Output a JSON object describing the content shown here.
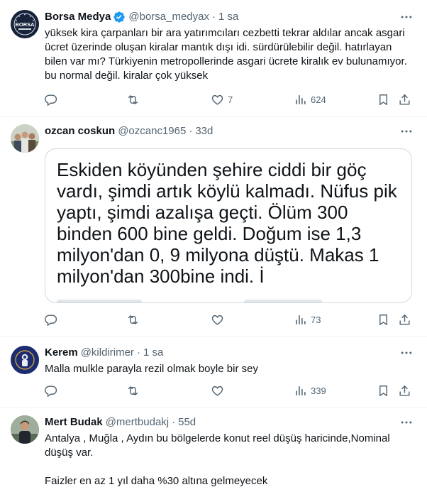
{
  "tweets": [
    {
      "name": "Borsa Medya",
      "handle": "@borsa_medyax",
      "dot": "·",
      "time": "1 sa",
      "text": "yüksek kira çarpanları bir ara yatırımcıları cezbetti tekrar aldılar ancak asgari ücret üzerinde oluşan kiralar mantık dışı idi. sürdürülebilir değil. hatırlayan bilen var mı? Türkiyenin metropollerinde asgari ücrete kiralık ev bulunamıyor. bu normal değil. kiralar çok yüksek",
      "replies": "",
      "retweets": "",
      "likes": "7",
      "views": "624",
      "avatar_text": "BORSA"
    },
    {
      "name": "ozcan coskun",
      "handle": "@ozcanc1965",
      "dot": "·",
      "time": "33d",
      "quote_text": "Eskiden köyünden şehire ciddi bir göç vardı, şimdi artık köylü kalmadı. Nüfus pik yaptı, şimdi azalışa geçti. Ölüm 300 binden 600 bine geldi. Doğum ise 1,3 milyon'dan 0, 9 milyona düştü. Makas 1 milyon'dan 300bine indi. İ",
      "replies": "",
      "retweets": "",
      "likes": "",
      "views": "73"
    },
    {
      "name": "Kerem",
      "handle": "@kildirimer",
      "dot": "·",
      "time": "1 sa",
      "text": "Malla mulkle parayla rezil olmak boyle bir sey",
      "replies": "",
      "retweets": "",
      "likes": "",
      "views": "339"
    },
    {
      "name": "Mert Budak",
      "handle": "@mertbudakj",
      "dot": "·",
      "time": "55d",
      "text": "Antalya , Muğla , Aydın bu bölgelerde konut reel düşüş haricinde,Nominal düşüş var.",
      "text2": "Faizler en az 1 yıl daha %30 altına gelmeyecek"
    }
  ],
  "colors": {
    "text": "#0f1419",
    "secondary": "#536471",
    "verified": "#1d9bf0",
    "border": "#eff3f4"
  },
  "icons": [
    "verified-badge-icon",
    "more-icon",
    "reply-icon",
    "retweet-icon",
    "like-icon",
    "views-icon",
    "bookmark-icon",
    "share-icon"
  ]
}
